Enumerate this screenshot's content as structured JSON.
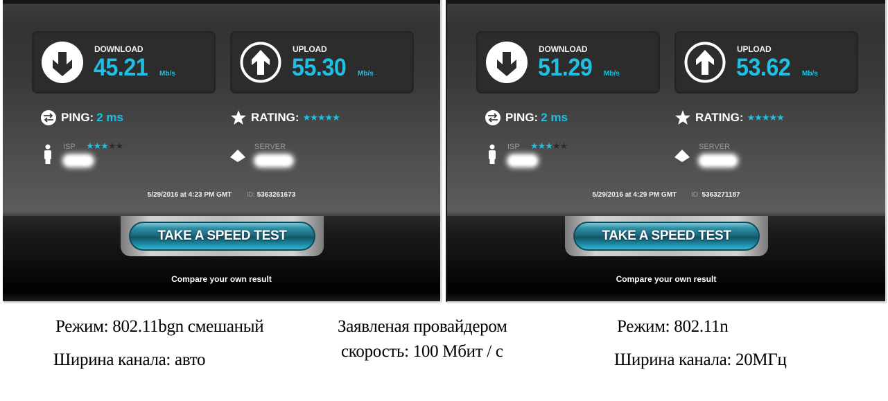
{
  "results": [
    {
      "download": {
        "label": "DOWNLOAD",
        "value": "45.21",
        "unit": "Mb/s",
        "icon": "download-arrow-icon"
      },
      "upload": {
        "label": "UPLOAD",
        "value": "55.30",
        "unit": "Mb/s",
        "icon": "upload-arrow-icon"
      },
      "ping": {
        "label": "PING:",
        "value": "2 ms",
        "icon": "ping-arrows-icon"
      },
      "rating": {
        "label": "RATING:",
        "stars_on": "★★★★★",
        "stars_off": "",
        "stars_value": 5,
        "stars_max": 5,
        "icon": "star-icon"
      },
      "isp": {
        "label": "ISP",
        "stars_on": "★★★",
        "stars_off": "★★",
        "stars_value": 3,
        "stars_max": 5,
        "icon": "person-icon",
        "name_redacted": true
      },
      "server": {
        "label": "SERVER",
        "icon": "server-pyramid-icon",
        "name_redacted": true
      },
      "timestamp": "5/29/2016 at 4:23 PM GMT",
      "id_label": "ID:",
      "id_value": "5363261673",
      "button_label": "TAKE A SPEED TEST",
      "compare_label": "Compare your own result"
    },
    {
      "download": {
        "label": "DOWNLOAD",
        "value": "51.29",
        "unit": "Mb/s",
        "icon": "download-arrow-icon"
      },
      "upload": {
        "label": "UPLOAD",
        "value": "53.62",
        "unit": "Mb/s",
        "icon": "upload-arrow-icon"
      },
      "ping": {
        "label": "PING:",
        "value": "2 ms",
        "icon": "ping-arrows-icon"
      },
      "rating": {
        "label": "RATING:",
        "stars_on": "★★★★★",
        "stars_off": "",
        "stars_value": 5,
        "stars_max": 5,
        "icon": "star-icon"
      },
      "isp": {
        "label": "ISP",
        "stars_on": "★★★",
        "stars_off": "★★",
        "stars_value": 3,
        "stars_max": 5,
        "icon": "person-icon",
        "name_redacted": true
      },
      "server": {
        "label": "SERVER",
        "icon": "server-pyramid-icon",
        "name_redacted": true
      },
      "timestamp": "5/29/2016 at 4:29 PM GMT",
      "id_label": "ID:",
      "id_value": "5363271187",
      "button_label": "TAKE A SPEED TEST",
      "compare_label": "Compare your own result"
    }
  ],
  "captions": {
    "left_mode": "Режим: 802.11bgn смешаный",
    "left_width": "Ширина канала: авто",
    "center_line1": "Заявленая провайдером",
    "center_line2": "скорость: 100 Мбит / с",
    "right_mode": "Режим: 802.11n",
    "right_width": "Ширина канала: 20МГц"
  },
  "colors": {
    "accent": "#1fc0e3",
    "panel_bg": "#333333",
    "button": "#1d6b80"
  }
}
